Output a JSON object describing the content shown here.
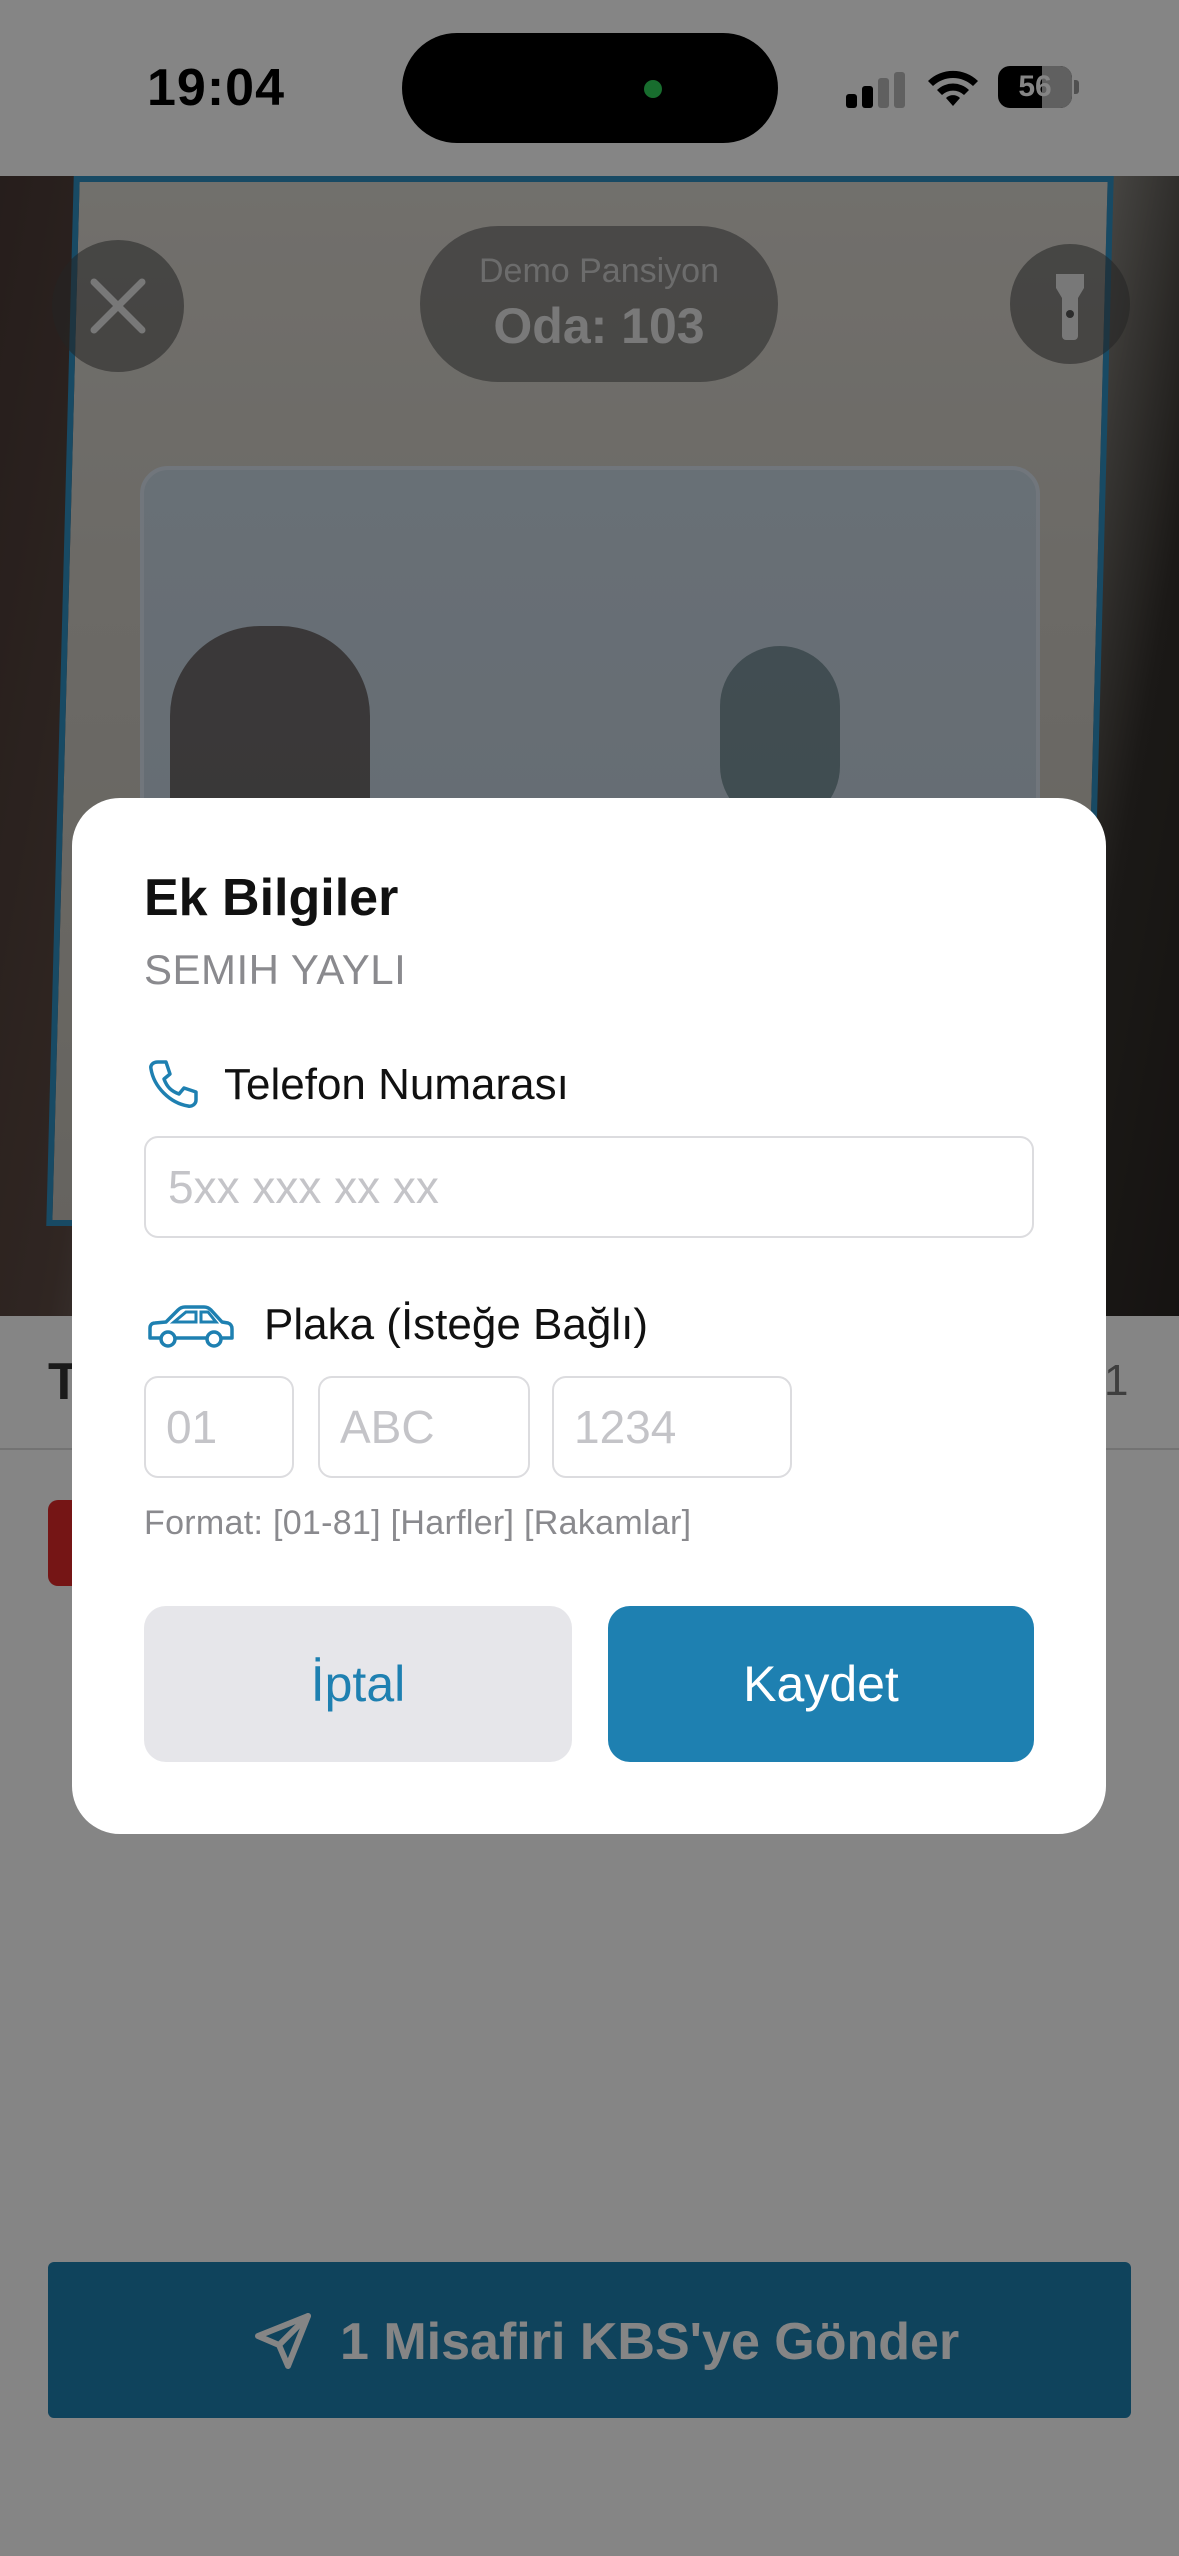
{
  "status_bar": {
    "time": "19:04",
    "battery": "56"
  },
  "scanner": {
    "pension_name": "Demo Pansiyon",
    "room": "Oda: 103"
  },
  "list": {
    "first_letter": "T",
    "count": "1"
  },
  "send_button": {
    "label": "1 Misafiri KBS'ye Gönder"
  },
  "dialog": {
    "title": "Ek Bilgiler",
    "guest_name": "SEMIH YAYLI",
    "phone": {
      "label": "Telefon Numarası",
      "placeholder": "5xx xxx xx xx",
      "value": ""
    },
    "plate": {
      "label": "Plaka (İsteğe Bağlı)",
      "city_placeholder": "01",
      "letters_placeholder": "ABC",
      "numbers_placeholder": "1234",
      "format_hint": "Format: [01-81] [Harfler] [Rakamlar]"
    },
    "cancel_label": "İptal",
    "save_label": "Kaydet"
  },
  "colors": {
    "accent": "#1e80b1",
    "cancel_bg": "#e6e6ea",
    "dim_overlay": "rgba(0,0,0,0.48)"
  },
  "icons": [
    "close-icon",
    "flashlight-icon",
    "phone-icon",
    "car-icon",
    "send-icon",
    "signal-icon",
    "wifi-icon",
    "battery-icon"
  ]
}
